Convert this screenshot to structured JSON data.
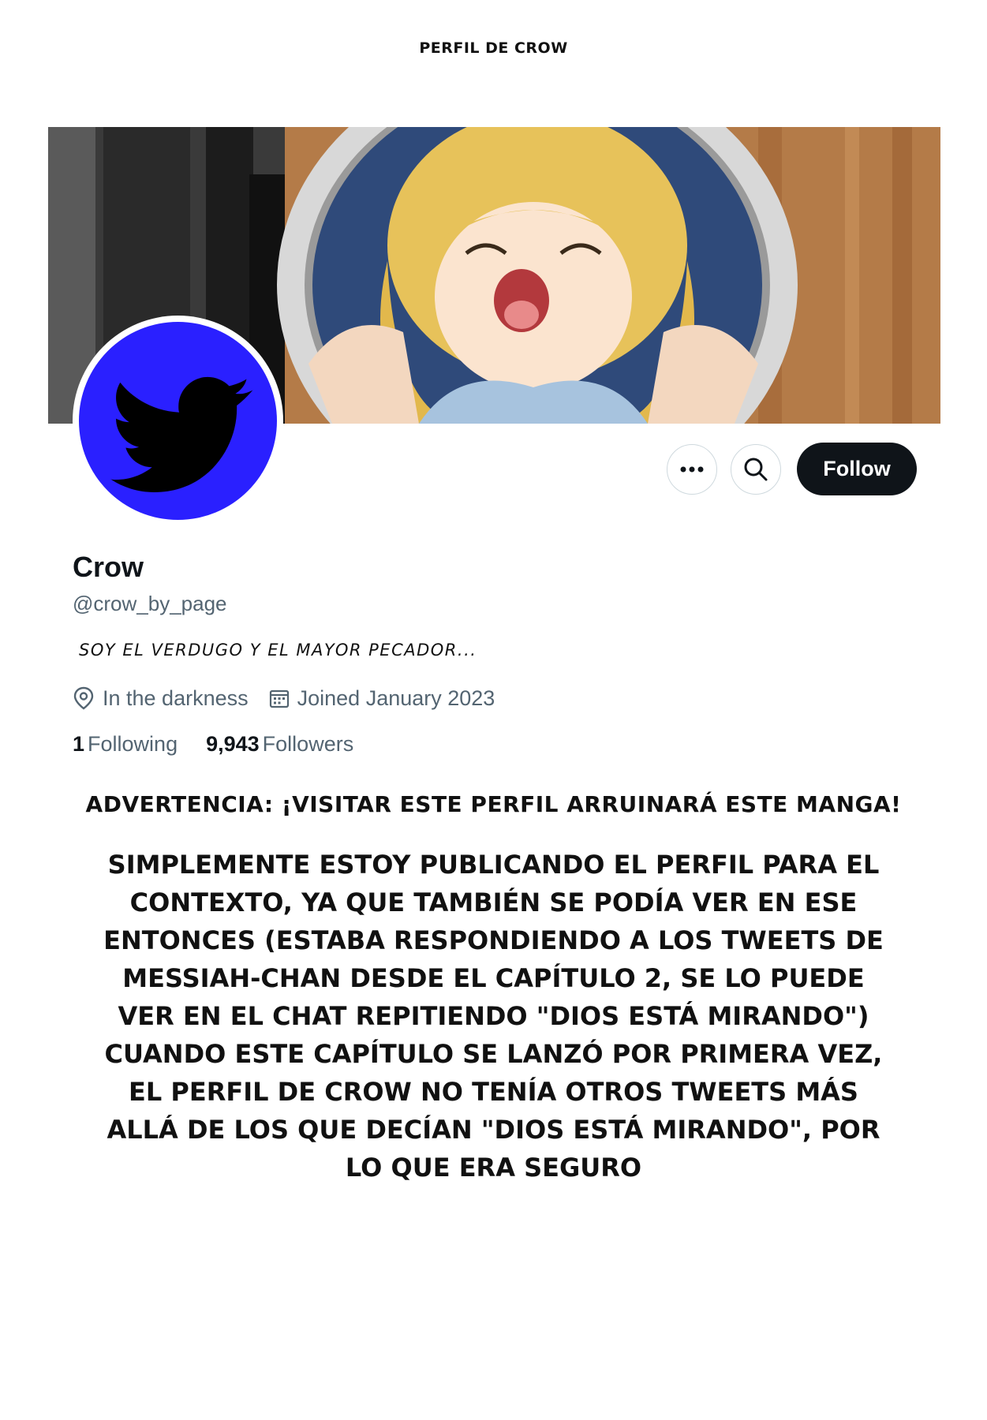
{
  "page_title": "PERFIL DE CROW",
  "profile": {
    "display_name": "Crow",
    "handle": "@crow_by_page",
    "bio": "SOY EL VERDUGO Y EL MAYOR PECADOR...",
    "location": "In the darkness",
    "joined": "Joined January 2023",
    "following_count": "1",
    "following_label": "Following",
    "followers_count": "9,943",
    "followers_label": "Followers"
  },
  "actions": {
    "more_icon": "more-options-icon",
    "search_icon": "search-icon",
    "follow_label": "Follow"
  },
  "icons": {
    "location": "location-pin-icon",
    "calendar": "calendar-icon",
    "avatar": "twitter-bird-icon"
  },
  "colors": {
    "avatar_bg": "#2a20ff",
    "follow_bg": "#0f1419",
    "secondary_text": "#536471"
  },
  "warning": "ADVERTENCIA: ¡VISITAR ESTE PERFIL ARRUINARÁ ESTE MANGA!",
  "note": "SIMPLEMENTE ESTOY PUBLICANDO EL PERFIL PARA EL CONTEXTO, YA QUE TAMBIÉN SE PODÍA VER EN ESE ENTONCES (ESTABA RESPONDIENDO A LOS TWEETS DE MESSIAH-CHAN DESDE EL CAPÍTULO 2, SE LO PUEDE VER EN EL CHAT REPITIENDO \"DIOS ESTÁ MIRANDO\") CUANDO ESTE CAPÍTULO SE LANZÓ POR PRIMERA VEZ, EL PERFIL DE CROW NO TENÍA OTROS TWEETS MÁS ALLÁ DE LOS QUE DECÍAN \"DIOS ESTÁ MIRANDO\", POR LO QUE ERA SEGURO"
}
